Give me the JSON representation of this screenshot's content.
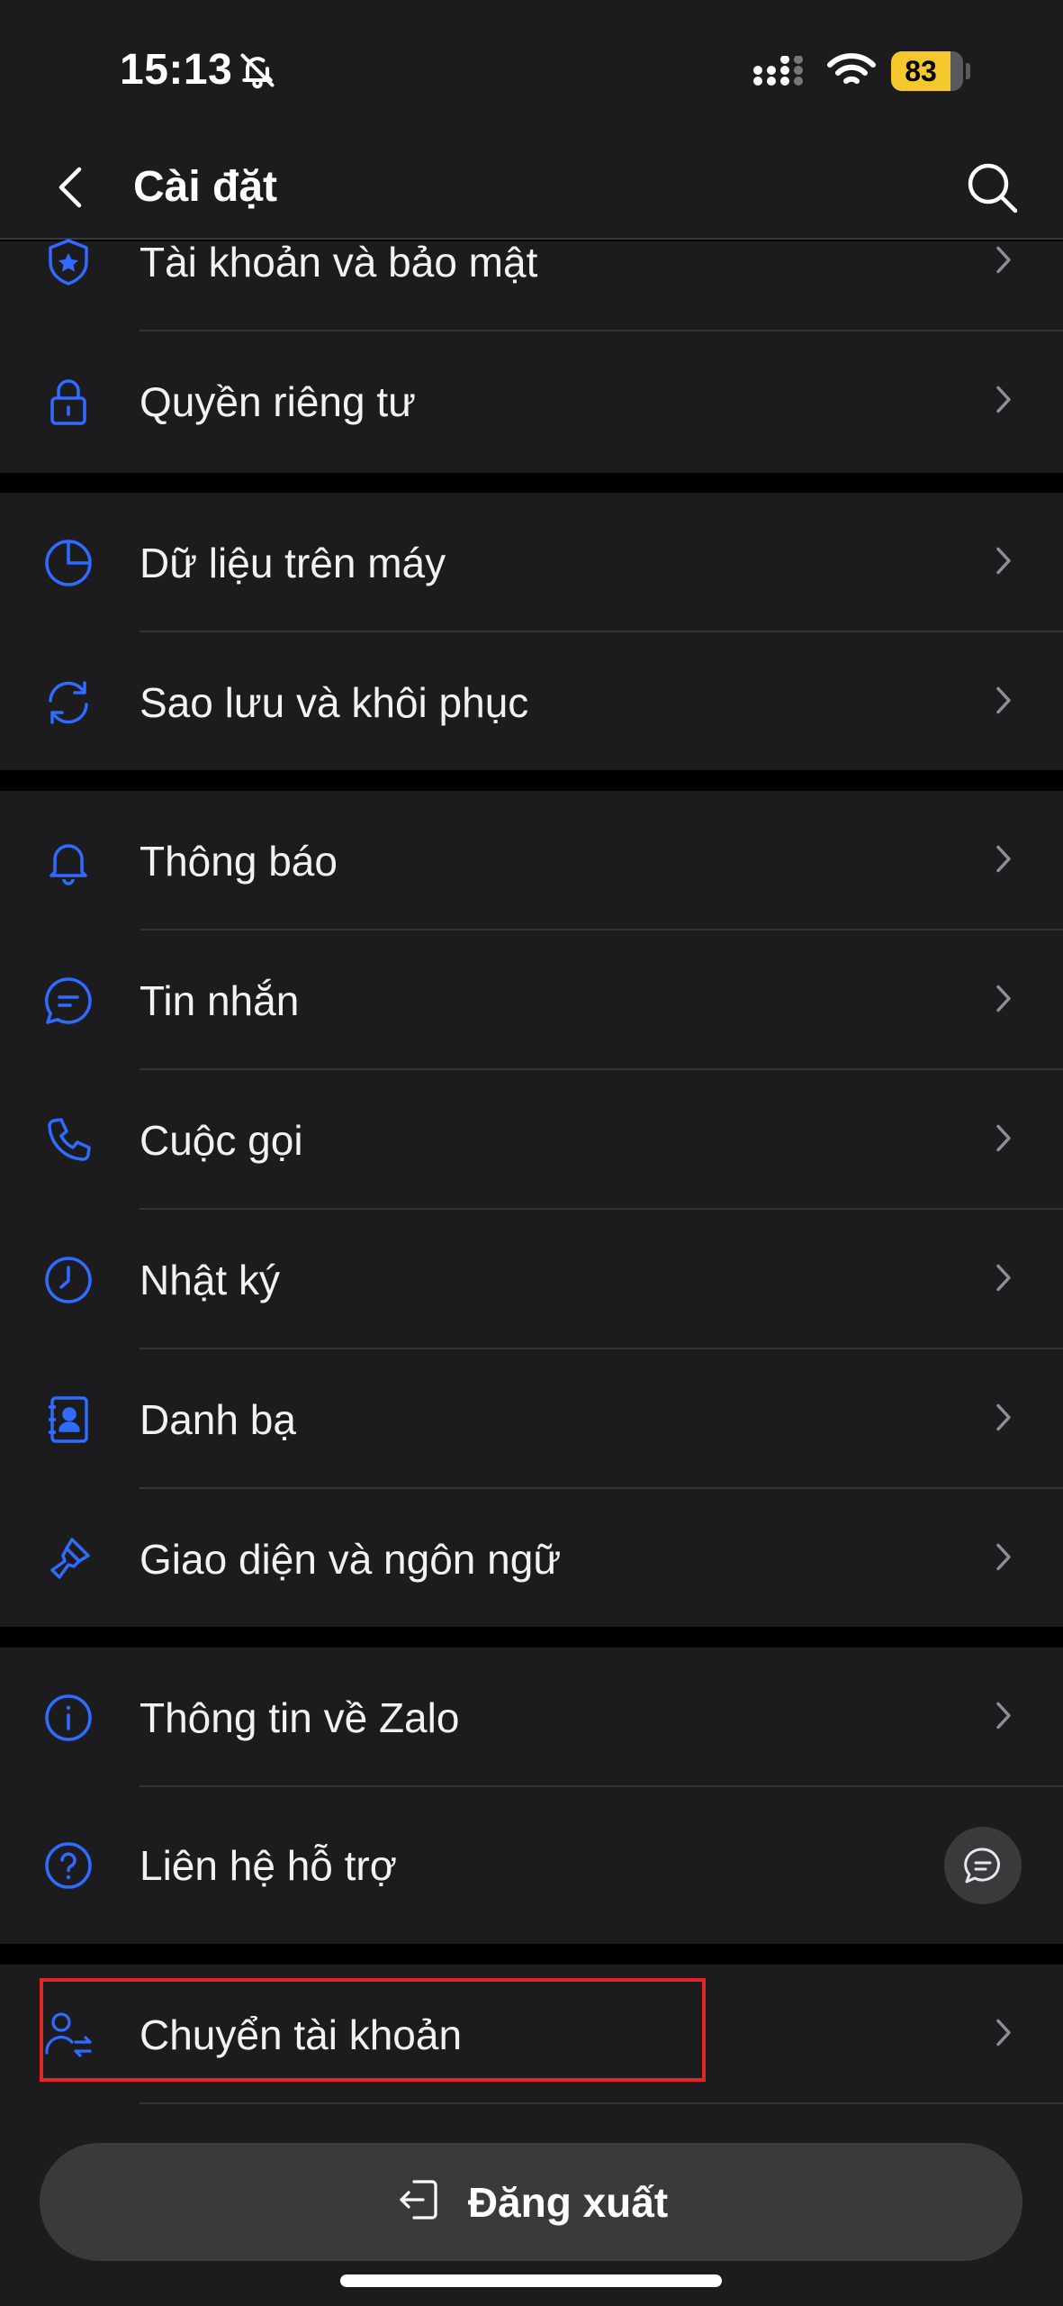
{
  "status": {
    "time": "15:13",
    "battery": "83",
    "battery_level": 0.83
  },
  "nav": {
    "title": "Cài đặt"
  },
  "groups": [
    {
      "items": [
        {
          "label": "Tài khoản và bảo mật",
          "icon": "shield-star-icon"
        },
        {
          "label": "Quyền riêng tư",
          "icon": "lock-icon"
        }
      ]
    },
    {
      "items": [
        {
          "label": "Dữ liệu trên máy",
          "icon": "pie-chart-icon"
        },
        {
          "label": "Sao lưu và khôi phục",
          "icon": "sync-icon"
        }
      ]
    },
    {
      "items": [
        {
          "label": "Thông báo",
          "icon": "bell-icon"
        },
        {
          "label": "Tin nhắn",
          "icon": "chat-icon"
        },
        {
          "label": "Cuộc gọi",
          "icon": "phone-icon"
        },
        {
          "label": "Nhật ký",
          "icon": "clock-icon"
        },
        {
          "label": "Danh bạ",
          "icon": "contacts-icon"
        },
        {
          "label": "Giao diện và ngôn ngữ",
          "icon": "paintbrush-icon"
        }
      ]
    },
    {
      "items": [
        {
          "label": "Thông tin về Zalo",
          "icon": "info-icon"
        },
        {
          "label": "Liên hệ hỗ trợ",
          "icon": "help-icon"
        }
      ]
    },
    {
      "items": [
        {
          "label": "Chuyển tài khoản",
          "icon": "switch-account-icon"
        }
      ]
    }
  ],
  "logout": {
    "label": "Đăng xuất"
  },
  "colors": {
    "accent": "#2f6bff",
    "background": "#1c1c1e",
    "highlight": "#e0262b"
  }
}
